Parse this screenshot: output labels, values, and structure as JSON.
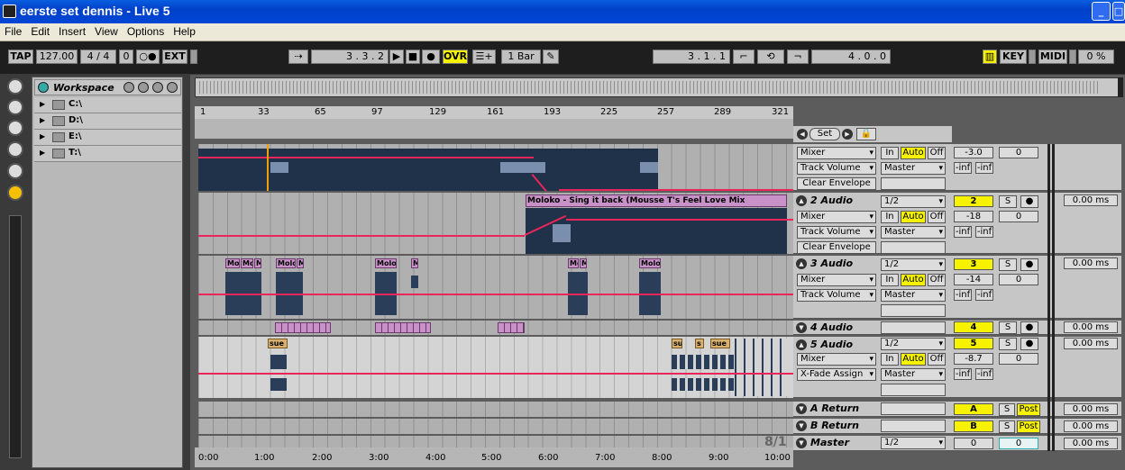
{
  "window": {
    "title": "eerste set dennis - Live 5"
  },
  "menu": [
    "File",
    "Edit",
    "Insert",
    "View",
    "Options",
    "Help"
  ],
  "transport": {
    "tap": "TAP",
    "tempo": "127.00",
    "signature": "4 / 4",
    "groove": "0",
    "ext": "EXT",
    "position": "3 .  3 .  2",
    "ovr": "OVR",
    "quantize": "1 Bar",
    "loop_start": "3 .  1 .  1",
    "loop_length": "4 .  0 .  0",
    "key": "KEY",
    "midi": "MIDI",
    "cpu": "0 %"
  },
  "browser": {
    "title": "Workspace",
    "drives": [
      "C:\\",
      "D:\\",
      "E:\\",
      "T:\\"
    ]
  },
  "ruler": {
    "bars": [
      "1",
      "33",
      "65",
      "97",
      "129",
      "161",
      "193",
      "225",
      "257",
      "289",
      "321"
    ]
  },
  "timeline": {
    "times": [
      "0:00",
      "1:00",
      "2:00",
      "3:00",
      "4:00",
      "5:00",
      "6:00",
      "7:00",
      "8:00",
      "9:00",
      "10:00"
    ],
    "signature_display": "8/1"
  },
  "set_button": "Set",
  "tracks": [
    {
      "name": "",
      "device": "Mixer",
      "param": "Track Volume",
      "envelope_btn": "Clear Envelope",
      "output": "Master",
      "vol": "-3.0",
      "pan": "0",
      "inf1": "-inf",
      "inf2": "-inf"
    },
    {
      "name": "2 Audio",
      "input": "1/2",
      "num": "2",
      "device": "Mixer",
      "param": "Track Volume",
      "envelope_btn": "Clear Envelope",
      "output": "Master",
      "vol": "-18",
      "pan": "0",
      "inf1": "-inf",
      "inf2": "-inf",
      "delay": "0.00 ms",
      "clip": "Moloko - Sing it back (Mousse T's Feel Love Mix"
    },
    {
      "name": "3 Audio",
      "input": "1/2",
      "num": "3",
      "device": "Mixer",
      "param": "Track Volume",
      "output": "Master",
      "vol": "-14",
      "pan": "0",
      "inf1": "-inf",
      "inf2": "-inf",
      "delay": "0.00 ms",
      "clips": [
        "Mo",
        "Mo",
        "M",
        "Molo",
        "M",
        "Molo",
        "M",
        "Mo",
        "M",
        "Molo"
      ]
    },
    {
      "name": "4 Audio",
      "num": "4",
      "delay": "0.00 ms"
    },
    {
      "name": "5 Audio",
      "input": "1/2",
      "num": "5",
      "device": "Mixer",
      "param": "X-Fade Assign",
      "output": "Master",
      "vol": "-8.7",
      "pan": "0",
      "inf1": "-inf",
      "inf2": "-inf",
      "delay": "0.00 ms",
      "clips": [
        "sue",
        "su",
        "s",
        "sue"
      ]
    },
    {
      "name": "A Return",
      "num": "A",
      "post": "Post",
      "delay": "0.00 ms"
    },
    {
      "name": "B Return",
      "num": "B",
      "post": "Post",
      "delay": "0.00 ms"
    },
    {
      "name": "Master",
      "input": "1/2",
      "num": "0",
      "pan": "0",
      "delay": "0.00 ms"
    }
  ],
  "labels": {
    "in": "In",
    "auto": "Auto",
    "off": "Off",
    "s": "S"
  },
  "colors": {
    "accent": "#f6f200",
    "automation": "#e8265a",
    "clip_header": "#c892c8",
    "clip_body": "#20324a",
    "clip_orange": "#d8b070"
  }
}
